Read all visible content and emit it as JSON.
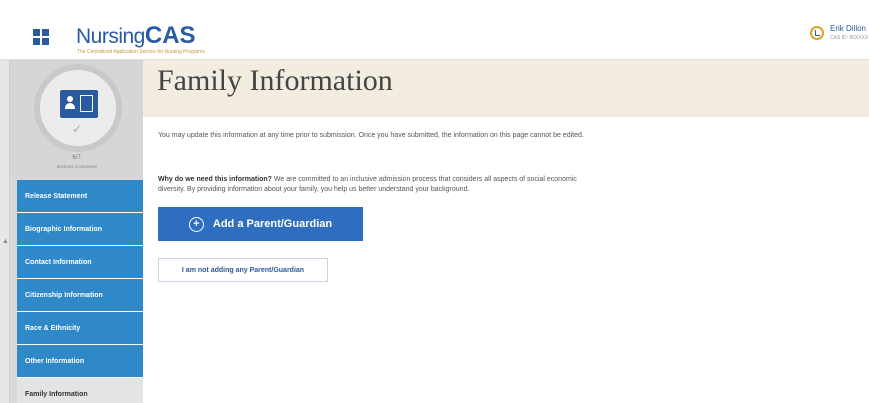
{
  "header": {
    "logo_text_1": "Nursing",
    "logo_text_2": "CAS",
    "tagline": "The Centralized Application Service for Nursing Programs",
    "user_name": "Erik Dillon",
    "user_id": "CAS ID: 85XXXX"
  },
  "progress": {
    "count": "6/7",
    "label": "Sections Completed"
  },
  "sidebar": {
    "items": [
      {
        "label": "Release Statement",
        "active": false
      },
      {
        "label": "Biographic Information",
        "active": false
      },
      {
        "label": "Contact Information",
        "active": false
      },
      {
        "label": "Citizenship Information",
        "active": false
      },
      {
        "label": "Race & Ethnicity",
        "active": false
      },
      {
        "label": "Other Information",
        "active": false
      },
      {
        "label": "Family Information",
        "active": true
      }
    ]
  },
  "main": {
    "title": "Family Information",
    "intro": "You may update this information at any time prior to submission. Once you have submitted, the information on this page cannot be edited.",
    "why_heading": "Why do we need this information?",
    "why_text": "We are committed to an inclusive admission process that considers all aspects of social economic diversity. By providing information about your family, you help us better understand your background.",
    "add_button": "Add a Parent/Guardian",
    "not_adding_button": "I am not adding any Parent/Guardian"
  },
  "colors": {
    "brand_blue": "#2a5a9f",
    "nav_blue": "#2f88c8",
    "button_blue": "#2f6ebf",
    "banner": "#f3ede1"
  }
}
